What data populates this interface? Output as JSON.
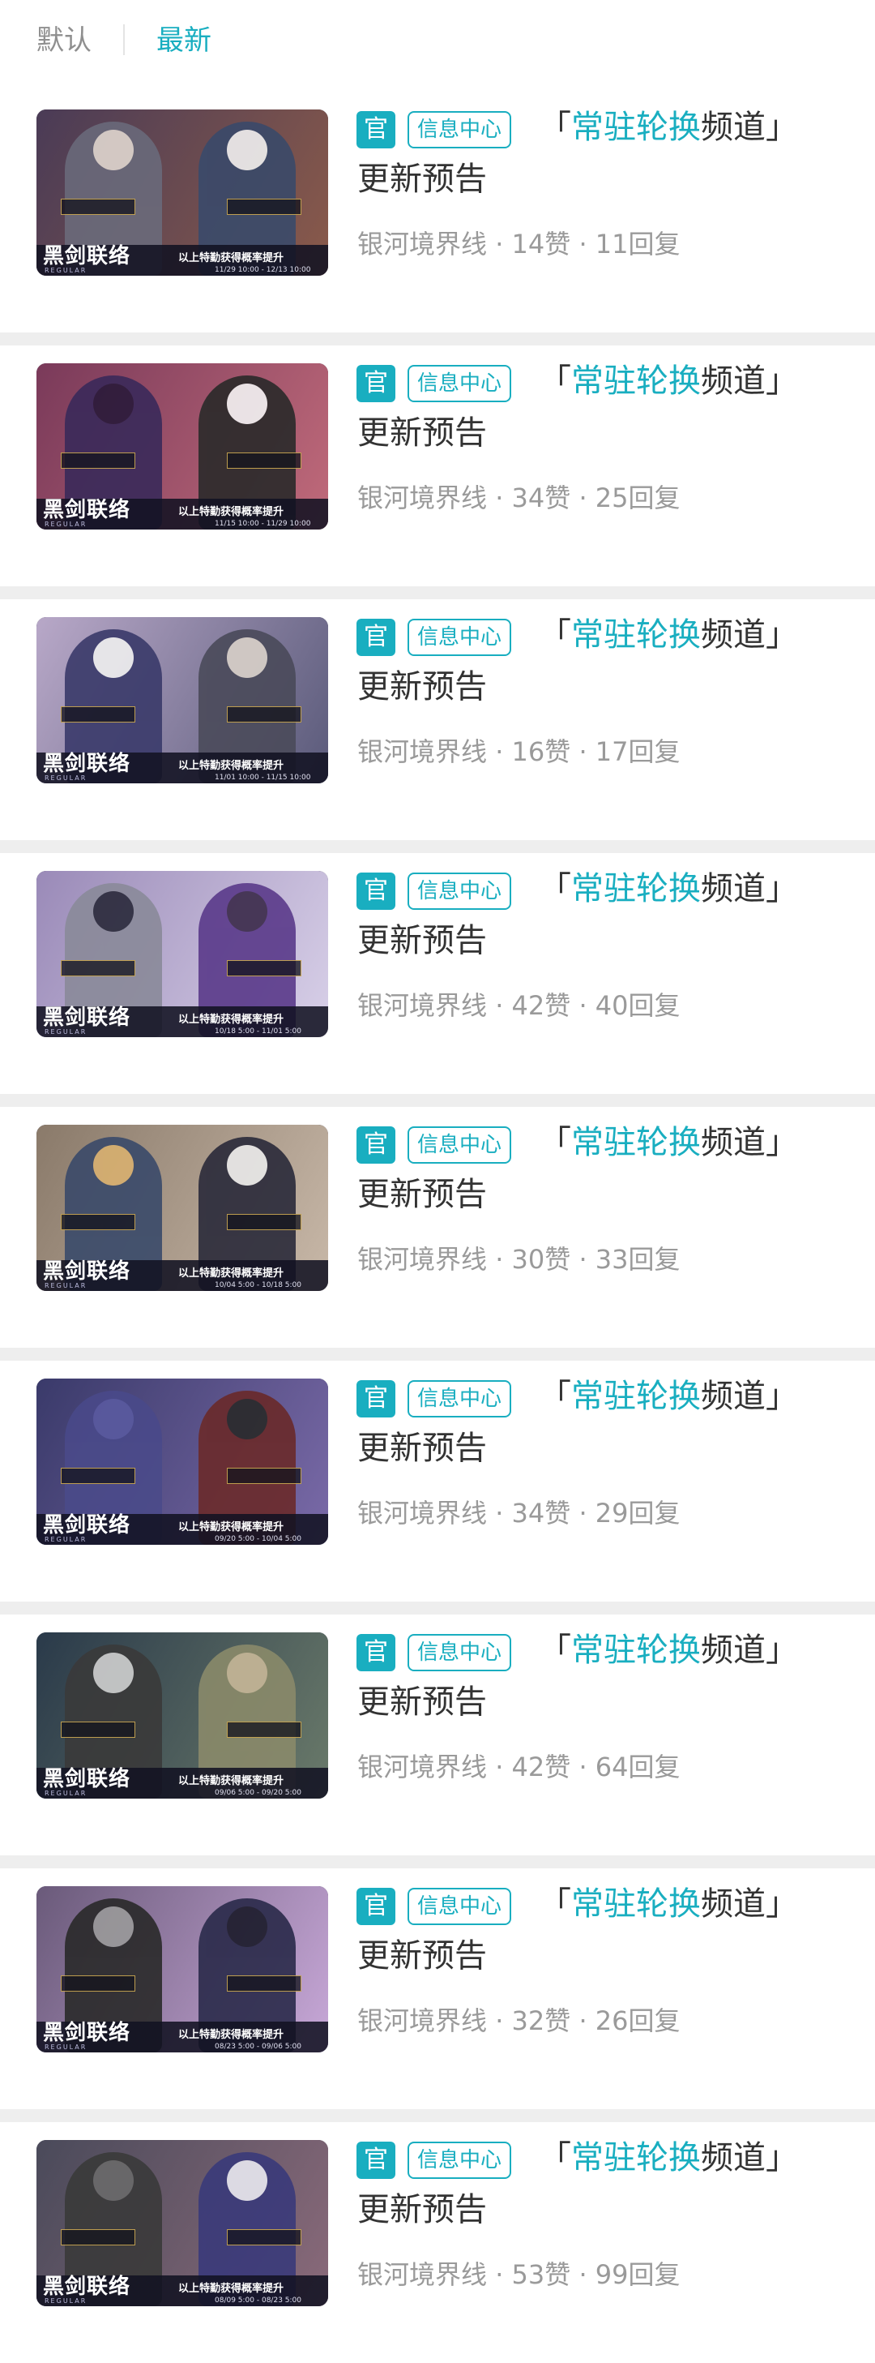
{
  "tabs": {
    "default": "默认",
    "latest": "最新"
  },
  "posts": [
    {
      "badge": "官",
      "tag": "信息中心",
      "title_open": "「",
      "title_highlight": "常驻轮换",
      "title_rest": "频道」",
      "title_line2": "更新预告",
      "source": "银河境界线",
      "likes": "14赞",
      "replies": "11回复",
      "banner": {
        "logo": "黑剑联络",
        "logo_sub": "REGULAR",
        "slogan": "以上特勤获得概率提升",
        "dates": "11/29 10:00 - 12/13 10:00"
      },
      "palette": {
        "bg1": "#4a3b56",
        "bg2": "#8a5a4a",
        "f1": "#6a6a7a",
        "f2": "#3a4a6a",
        "h1": "#e0d8d0",
        "h2": "#f0f0f0"
      }
    },
    {
      "badge": "官",
      "tag": "信息中心",
      "title_open": "「",
      "title_highlight": "常驻轮换",
      "title_rest": "频道」",
      "title_line2": "更新预告",
      "source": "银河境界线",
      "likes": "34赞",
      "replies": "25回复",
      "banner": {
        "logo": "黑剑联络",
        "logo_sub": "REGULAR",
        "slogan": "以上特勤获得概率提升",
        "dates": "11/15 10:00 - 11/29 10:00"
      },
      "palette": {
        "bg1": "#7a3a5a",
        "bg2": "#c06a7a",
        "f1": "#3a2a5a",
        "f2": "#2a2a2a",
        "h1": "#2a1a3a",
        "h2": "#f2f2f2"
      }
    },
    {
      "badge": "官",
      "tag": "信息中心",
      "title_open": "「",
      "title_highlight": "常驻轮换",
      "title_rest": "频道」",
      "title_line2": "更新预告",
      "source": "银河境界线",
      "likes": "16赞",
      "replies": "17回复",
      "banner": {
        "logo": "黑剑联络",
        "logo_sub": "REGULAR",
        "slogan": "以上特勤获得概率提升",
        "dates": "11/01 10:00 - 11/15 10:00"
      },
      "palette": {
        "bg1": "#b8a8c8",
        "bg2": "#5a5a7a",
        "f1": "#3a3a6a",
        "f2": "#4a4a5a",
        "h1": "#eeeeee",
        "h2": "#d8d0c8"
      }
    },
    {
      "badge": "官",
      "tag": "信息中心",
      "title_open": "「",
      "title_highlight": "常驻轮换",
      "title_rest": "频道」",
      "title_line2": "更新预告",
      "source": "银河境界线",
      "likes": "42赞",
      "replies": "40回复",
      "banner": {
        "logo": "黑剑联络",
        "logo_sub": "REGULAR",
        "slogan": "以上特勤获得概率提升",
        "dates": "10/18 5:00 - 11/01 5:00"
      },
      "palette": {
        "bg1": "#9a8ab8",
        "bg2": "#d8d0e8",
        "f1": "#8a8a9a",
        "f2": "#5a3a8a",
        "h1": "#2a2a3a",
        "h2": "#3a2a4a"
      }
    },
    {
      "badge": "官",
      "tag": "信息中心",
      "title_open": "「",
      "title_highlight": "常驻轮换",
      "title_rest": "频道」",
      "title_line2": "更新预告",
      "source": "银河境界线",
      "likes": "30赞",
      "replies": "33回复",
      "banner": {
        "logo": "黑剑联络",
        "logo_sub": "REGULAR",
        "slogan": "以上特勤获得概率提升",
        "dates": "10/04 5:00 - 10/18 5:00"
      },
      "palette": {
        "bg1": "#8a7a6a",
        "bg2": "#c8b8a8",
        "f1": "#3a4a6a",
        "f2": "#2a2a3a",
        "h1": "#d8b070",
        "h2": "#e8e8e8"
      }
    },
    {
      "badge": "官",
      "tag": "信息中心",
      "title_open": "「",
      "title_highlight": "常驻轮换",
      "title_rest": "频道」",
      "title_line2": "更新预告",
      "source": "银河境界线",
      "likes": "34赞",
      "replies": "29回复",
      "banner": {
        "logo": "黑剑联络",
        "logo_sub": "REGULAR",
        "slogan": "以上特勤获得概率提升",
        "dates": "09/20 5:00 - 10/04 5:00"
      },
      "palette": {
        "bg1": "#3a3a6a",
        "bg2": "#7a6aa8",
        "f1": "#4a4a8a",
        "f2": "#6a2a2a",
        "h1": "#5a5aa0",
        "h2": "#2a2a2a"
      }
    },
    {
      "badge": "官",
      "tag": "信息中心",
      "title_open": "「",
      "title_highlight": "常驻轮换",
      "title_rest": "频道」",
      "title_line2": "更新预告",
      "source": "银河境界线",
      "likes": "42赞",
      "replies": "64回复",
      "banner": {
        "logo": "黑剑联络",
        "logo_sub": "REGULAR",
        "slogan": "以上特勤获得概率提升",
        "dates": "09/06 5:00 - 09/20 5:00"
      },
      "palette": {
        "bg1": "#2a3a4a",
        "bg2": "#6a7a6a",
        "f1": "#3a3a3a",
        "f2": "#8a8a6a",
        "h1": "#cfcfcf",
        "h2": "#c8b898"
      }
    },
    {
      "badge": "官",
      "tag": "信息中心",
      "title_open": "「",
      "title_highlight": "常驻轮换",
      "title_rest": "频道」",
      "title_line2": "更新预告",
      "source": "银河境界线",
      "likes": "32赞",
      "replies": "26回复",
      "banner": {
        "logo": "黑剑联络",
        "logo_sub": "REGULAR",
        "slogan": "以上特勤获得概率提升",
        "dates": "08/23 5:00 - 09/06 5:00"
      },
      "palette": {
        "bg1": "#6a5a7a",
        "bg2": "#c8a8d8",
        "f1": "#2a2a2a",
        "f2": "#2a2a4a",
        "h1": "#9a9a9a",
        "h2": "#1a1a2a"
      }
    },
    {
      "badge": "官",
      "tag": "信息中心",
      "title_open": "「",
      "title_highlight": "常驻轮换",
      "title_rest": "频道」",
      "title_line2": "更新预告",
      "source": "银河境界线",
      "likes": "53赞",
      "replies": "99回复",
      "banner": {
        "logo": "黑剑联络",
        "logo_sub": "REGULAR",
        "slogan": "以上特勤获得概率提升",
        "dates": "08/09 5:00 - 08/23 5:00"
      },
      "palette": {
        "bg1": "#4a4a5a",
        "bg2": "#8a6a7a",
        "f1": "#3a3a3a",
        "f2": "#3a3a7a",
        "h1": "#6a6a6a",
        "h2": "#e8e8f0"
      }
    }
  ],
  "meta_separator": " · "
}
